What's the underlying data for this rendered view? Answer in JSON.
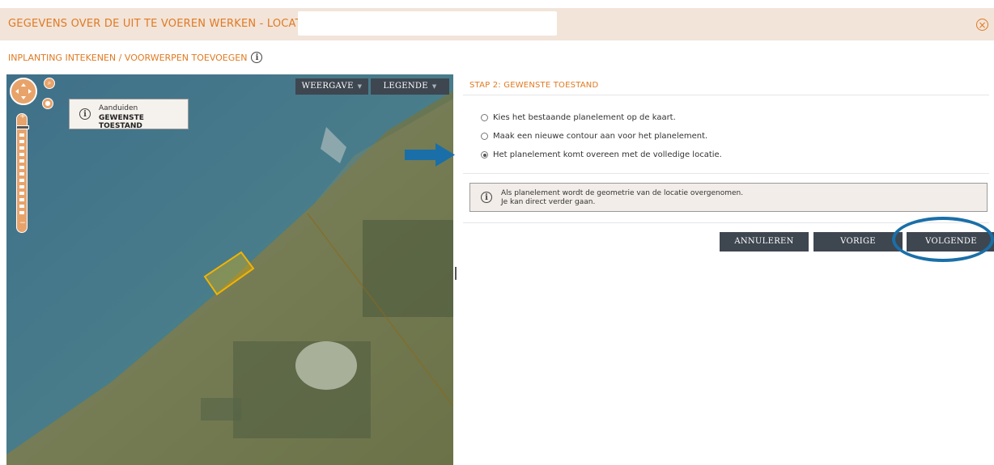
{
  "header": {
    "title": "GEGEVENS OVER DE UIT TE VOEREN WERKEN - LOCATIE: K",
    "close_icon": "close-circle-icon"
  },
  "subheader": {
    "label": "INPLANTING INTEKENEN / VOORWERPEN TOEVOEGEN",
    "info_glyph": "i"
  },
  "map": {
    "toolbar": {
      "weergave": "WEERGAVE",
      "legende": "LEGENDE",
      "caret": "▼"
    },
    "tooltip": {
      "line1": "Aanduiden",
      "line2": "GEWENSTE TOESTAND"
    },
    "controls": {
      "zoom_in": "+",
      "zoom_out": "−"
    },
    "colors": {
      "water": "#3f6f86",
      "land": "#6c7a5c",
      "highlight": "#f0b400"
    }
  },
  "panel": {
    "title": "STAP 2: GEWENSTE TOESTAND",
    "options": [
      {
        "label": "Kies het bestaande planelement op de kaart.",
        "checked": false
      },
      {
        "label": "Maak een nieuwe contour aan voor het planelement.",
        "checked": false
      },
      {
        "label": "Het planelement komt overeen met de volledige locatie.",
        "checked": true
      }
    ],
    "info": {
      "line1": "Als planelement wordt de geometrie van de locatie overgenomen.",
      "line2": "Je kan direct verder gaan."
    },
    "buttons": {
      "annuleren": "ANNULEREN",
      "vorige": "VORIGE",
      "volgende": "VOLGENDE"
    },
    "accent_color": "#e07a22",
    "annotation_color": "#1a6fa8"
  }
}
